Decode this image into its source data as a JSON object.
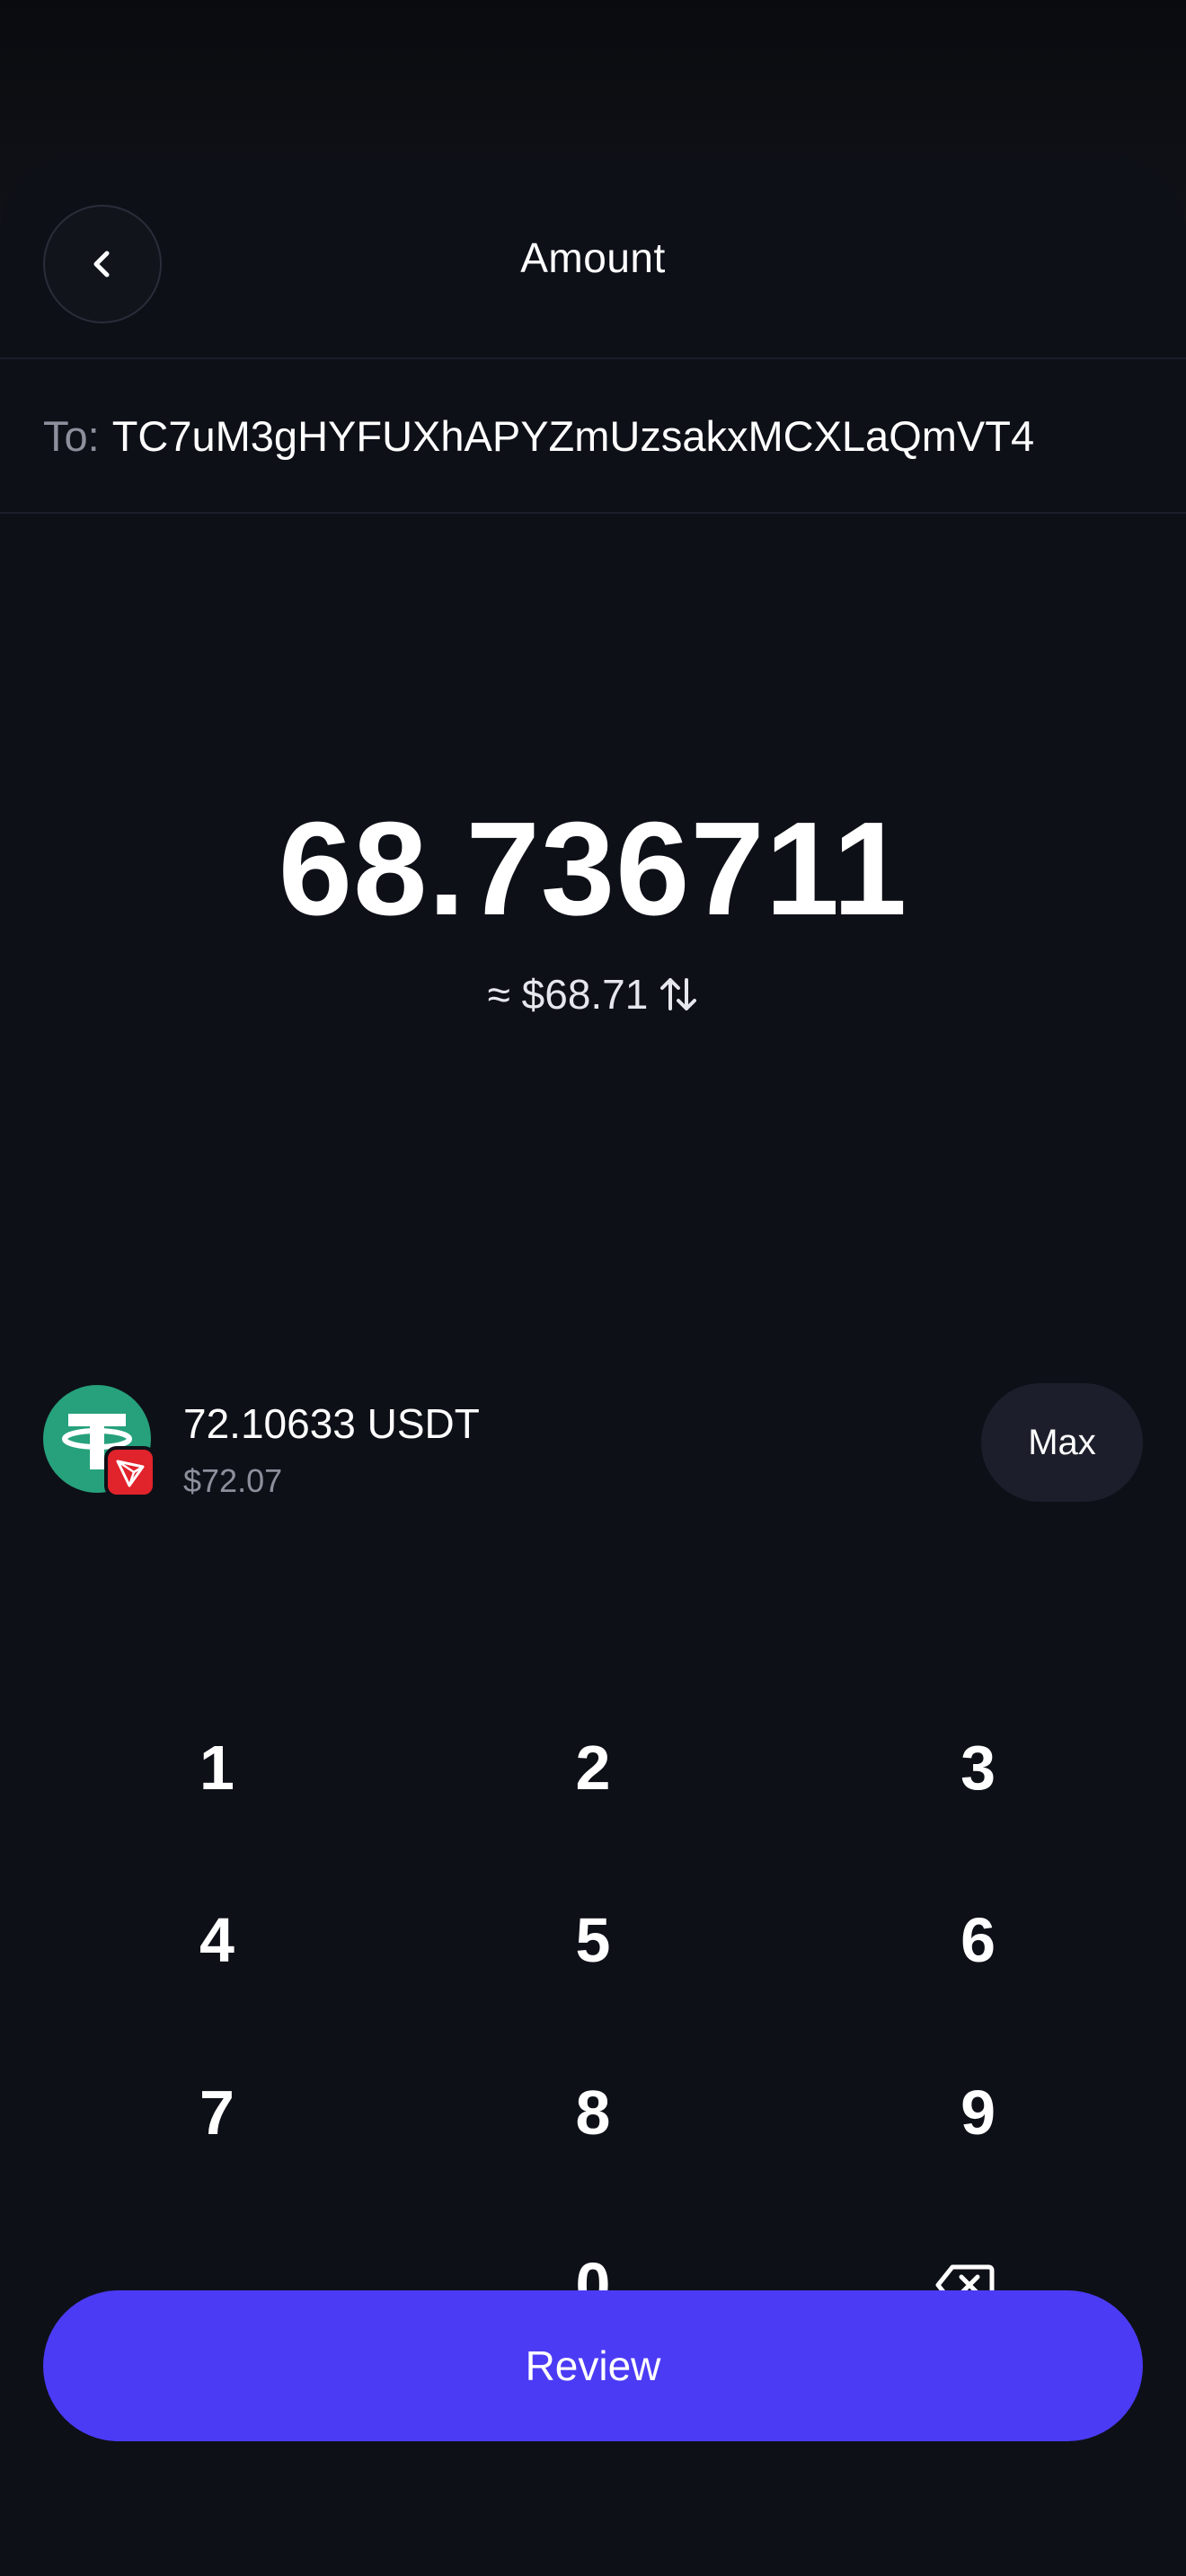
{
  "header": {
    "title": "Amount",
    "back_icon": "chevron-left-icon"
  },
  "recipient": {
    "label": "To:",
    "address": "TC7uM3gHYFUXhAPYZmUzsakxMCXLaQmVT4"
  },
  "amount": {
    "value": "68.736711",
    "fiat_equivalent": "≈ $68.71",
    "swap_icon": "swap-vertical-icon"
  },
  "asset": {
    "balance": "72.10633 USDT",
    "fiat_balance": "$72.07",
    "token_icon": "tether-icon",
    "chain_icon": "tron-icon",
    "max_label": "Max"
  },
  "keypad": {
    "keys": [
      "1",
      "2",
      "3",
      "4",
      "5",
      "6",
      "7",
      "8",
      "9",
      ".",
      "0"
    ],
    "backspace_icon": "backspace-icon"
  },
  "review_label": "Review",
  "colors": {
    "background": "#0e1018",
    "accent": "#4b3bf5",
    "tether": "#26a17b",
    "tron": "#e1232b"
  }
}
